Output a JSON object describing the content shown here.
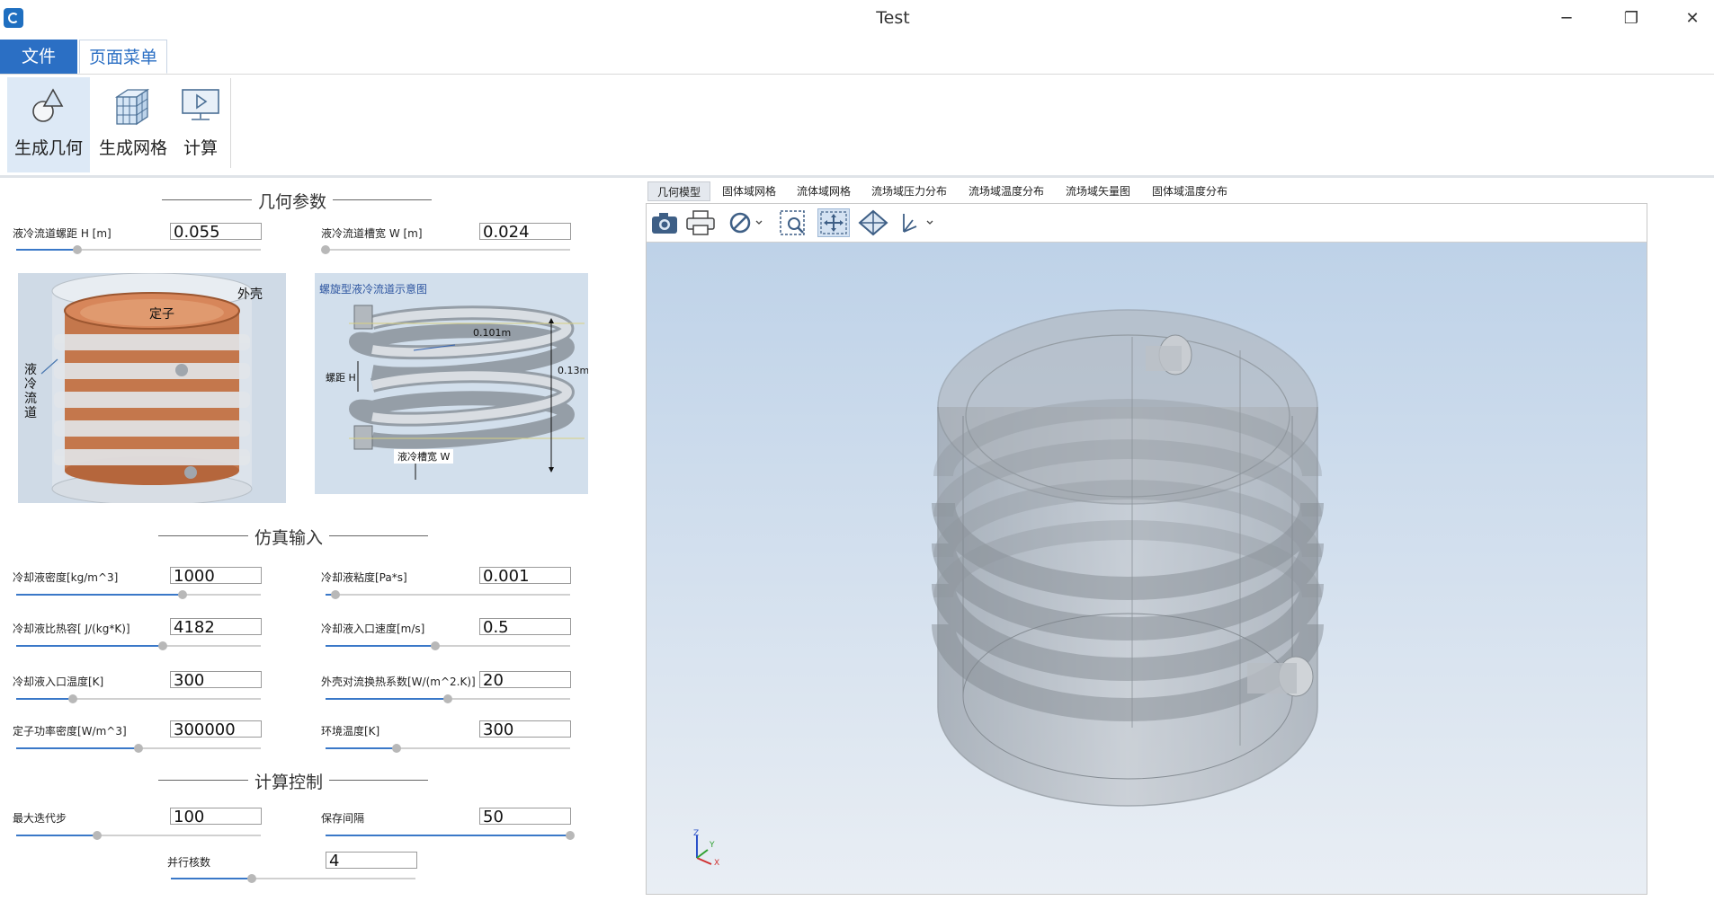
{
  "window": {
    "title": "Test",
    "minimize": "─",
    "maximize": "❐",
    "close": "✕"
  },
  "menu": {
    "file": "文件",
    "page_menu": "页面菜单"
  },
  "ribbon": {
    "gen_geometry": "生成几何",
    "gen_mesh": "生成网格",
    "compute": "计算"
  },
  "sections": {
    "geometry": "几何参数",
    "sim_input": "仿真输入",
    "calc_control": "计算控制"
  },
  "geometry_params": [
    {
      "label": "液冷流道螺距 H [m]",
      "value": "0.055",
      "level": 0.25
    },
    {
      "label": "液冷流道槽宽 W [m]",
      "value": "0.024",
      "level": 0.0
    }
  ],
  "image_left": {
    "shell": "外壳",
    "stator": "定子",
    "channel": "液冷流道"
  },
  "image_right": {
    "title": "螺旋型液冷流道示意图",
    "radius": "0.101m",
    "height": "0.13m",
    "pitch": "螺距 H",
    "width": "液冷槽宽 W"
  },
  "sim_params": [
    {
      "label": "冷却液密度[kg/m^3]",
      "value": "1000",
      "level": 0.68
    },
    {
      "label": "冷却液粘度[Pa*s]",
      "value": "0.001",
      "level": 0.04
    },
    {
      "label": "冷却液比热容[ J/(kg*K)]",
      "value": "4182",
      "level": 0.6
    },
    {
      "label": "冷却液入口速度[m/s]",
      "value": "0.5",
      "level": 0.45
    },
    {
      "label": "冷却液入口温度[K]",
      "value": "300",
      "level": 0.23
    },
    {
      "label": "外壳对流换热系数[W/(m^2.K)]",
      "value": "20",
      "level": 0.5
    },
    {
      "label": "定子功率密度[W/m^3]",
      "value": "300000",
      "level": 0.5
    },
    {
      "label": "环境温度[K]",
      "value": "300",
      "level": 0.29
    }
  ],
  "calc_params": [
    {
      "label": "最大迭代步",
      "value": "100",
      "level": 0.33
    },
    {
      "label": "保存间隔",
      "value": "50",
      "level": 1.0
    },
    {
      "label": "并行核数",
      "value": "4",
      "level": 0.33
    }
  ],
  "tabs": [
    "几何模型",
    "固体域网格",
    "流体域网格",
    "流场域压力分布",
    "流场域温度分布",
    "流场域矢量图",
    "固体域温度分布"
  ],
  "axes": {
    "z": "Z",
    "y": "Y",
    "x": "X"
  },
  "colors": {
    "accent": "#2b6fc4",
    "slider_fill": "#3a78c8",
    "viewport_top": "#bed2e8",
    "viewport_bottom": "#e9eef4"
  }
}
